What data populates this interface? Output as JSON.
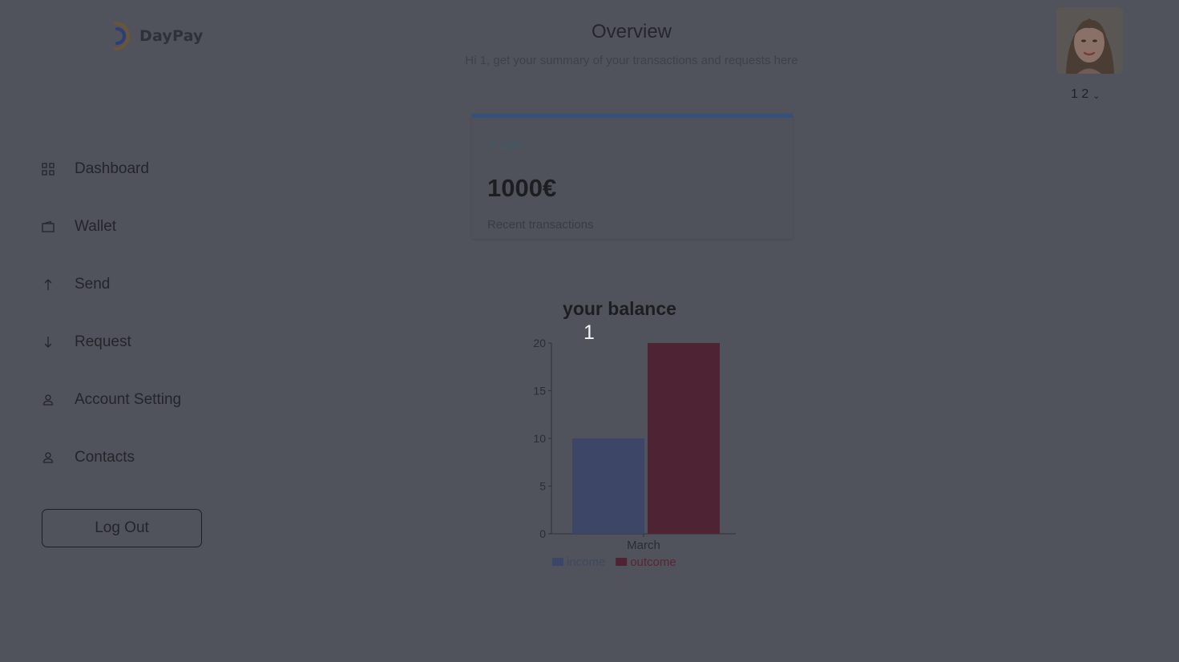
{
  "app": {
    "name": "DayPay"
  },
  "header": {
    "title": "Overview",
    "subtitle": "Hi 1, get your summary of your transactions and requests here"
  },
  "user": {
    "display_name": "1 2"
  },
  "sidebar": {
    "items": [
      {
        "label": "Dashboard",
        "icon": "dashboard-icon"
      },
      {
        "label": "Wallet",
        "icon": "wallet-icon"
      },
      {
        "label": "Send",
        "icon": "arrow-up-icon"
      },
      {
        "label": "Request",
        "icon": "arrow-down-icon"
      },
      {
        "label": "Account Setting",
        "icon": "user-icon"
      },
      {
        "label": "Contacts",
        "icon": "user-icon"
      }
    ],
    "logout_label": "Log Out"
  },
  "card": {
    "trend": "23%",
    "amount": "1000€",
    "caption": "Recent transactions"
  },
  "chart_data": {
    "type": "bar",
    "title": "your balance",
    "categories": [
      "March"
    ],
    "series": [
      {
        "name": "income",
        "values": [
          10
        ],
        "color": "#3e4668"
      },
      {
        "name": "outcome",
        "values": [
          20
        ],
        "color": "#4e2333"
      }
    ],
    "ylim": [
      0,
      20
    ],
    "yticks": [
      0,
      5,
      10,
      15,
      20
    ],
    "annotation": "1",
    "legend": "bottom"
  }
}
